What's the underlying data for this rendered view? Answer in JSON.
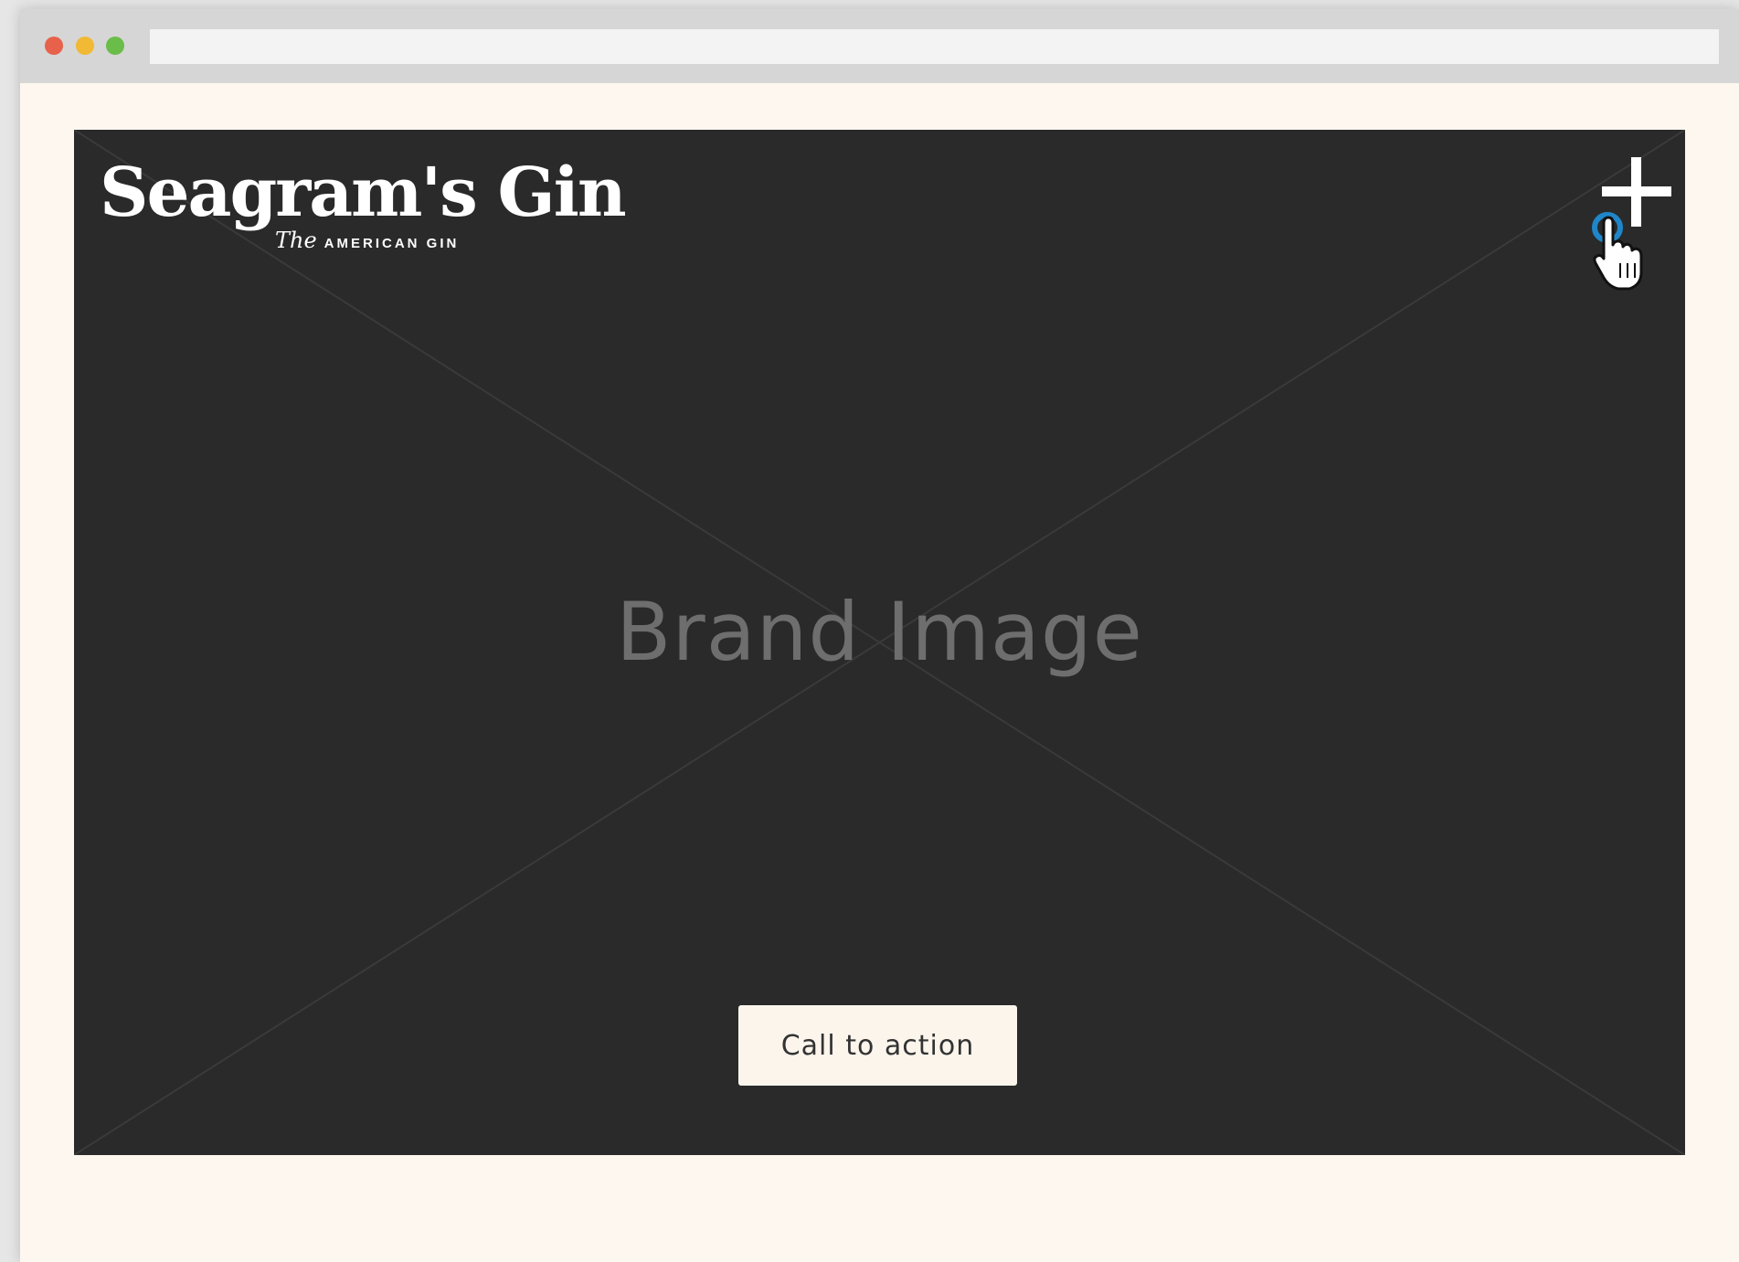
{
  "window": {
    "controls": {
      "close_color": "#e8614a",
      "minimize_color": "#f1b934",
      "zoom_color": "#6bbd4a"
    },
    "url": ""
  },
  "hero": {
    "background_color": "#2a2a2b",
    "logo": {
      "brand": "Seagram's Gin",
      "tagline_prefix": "The",
      "tagline": "AMERICAN GIN"
    },
    "menu_icon": "plus-icon",
    "cursor_icon": "hand-pointer-icon",
    "placeholder_label": "Brand Image",
    "cta_label": "Call to action"
  }
}
